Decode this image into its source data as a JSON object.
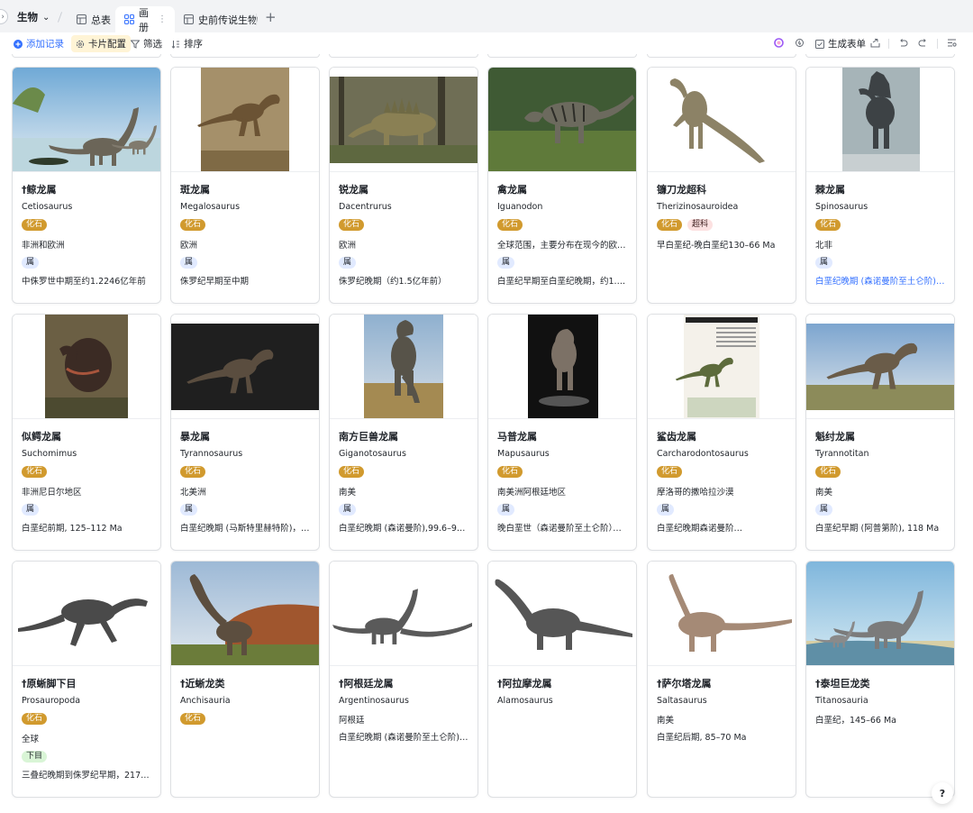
{
  "topbar": {
    "base_name": "生物",
    "tabs": [
      {
        "label": "总表",
        "icon": "grid-table-icon"
      },
      {
        "label": "画册",
        "icon": "gallery-icon",
        "active": true
      },
      {
        "label": "史前传说生物",
        "icon": "grid-table-icon"
      }
    ],
    "add_tab": "+"
  },
  "toolbar": {
    "add_record": "添加记录",
    "card_config": "卡片配置",
    "filter": "筛选",
    "sort": "排序",
    "generate_form": "生成表单"
  },
  "colors": {
    "accent": "#3370ff",
    "fossil_tag": "#d19a2e",
    "genus_tag": "#e1eaff",
    "superfamily_tag": "#fce1e1",
    "order_tag": "#d9f5d6"
  },
  "cards": [
    {
      "title": "†鲸龙属",
      "latin": "Cetiosaurus",
      "tags": [
        "化石"
      ],
      "region": "非洲和欧洲",
      "rank": "属",
      "period": "中侏罗世中期至约1.2246亿年前",
      "img": "sauropod-lake"
    },
    {
      "title": "斑龙属",
      "latin": "Megalosaurus",
      "tags": [
        "化石"
      ],
      "region": "欧洲",
      "rank": "属",
      "period": "侏罗纪早期至中期",
      "img": "theropod-brown"
    },
    {
      "title": "锐龙属",
      "latin": "Dacentrurus",
      "tags": [
        "化石"
      ],
      "region": "欧洲",
      "rank": "属",
      "period": "侏罗纪晚期（约1.5亿年前）",
      "img": "stegosaur-forest"
    },
    {
      "title": "禽龙属",
      "latin": "Iguanodon",
      "tags": [
        "化石"
      ],
      "region": "全球范围，主要分布在现今的欧洲…",
      "rank": "属",
      "period": "白垩纪早期至白垩纪晚期，约1.45…",
      "img": "iguanodon-jungle"
    },
    {
      "title": "镰刀龙超科",
      "latin": "Therizinosauroidea",
      "tags": [
        "化石",
        "超科"
      ],
      "region": "早白垩纪-晚白垩纪130–66 Ma",
      "rank": "",
      "period": "",
      "img": "therizino-white"
    },
    {
      "title": "棘龙属",
      "latin": "Spinosaurus",
      "tags": [
        "化石"
      ],
      "region": "北非",
      "rank": "属",
      "period": "白垩纪晚期 (森诺曼阶至土仑阶)，9…",
      "period_link": true,
      "img": "spinosaurus-mist"
    },
    {
      "title": "似鳄龙属",
      "latin": "Suchomimus",
      "tags": [
        "化石"
      ],
      "region": "非洲尼日尔地区",
      "rank": "属",
      "period": "白垩纪前期, 125–112 Ma",
      "img": "suchomimus-wood"
    },
    {
      "title": "暴龙属",
      "latin": "Tyrannosaurus",
      "tags": [
        "化石"
      ],
      "region": "北美洲",
      "rank": "属",
      "period": "白垩纪晚期 (马斯特里赫特阶)，68…",
      "img": "trex-dark"
    },
    {
      "title": "南方巨兽龙属",
      "latin": "Giganotosaurus",
      "tags": [
        "化石"
      ],
      "region": "南美",
      "rank": "属",
      "period": "白垩纪晚期 (森诺曼阶),99.6–97 Ma",
      "img": "giganoto-plain"
    },
    {
      "title": "马普龙属",
      "latin": "Mapusaurus",
      "tags": [
        "化石"
      ],
      "region": "南美洲阿根廷地区",
      "rank": "属",
      "period": "晚白垩世（森诺曼阶至土仑阶），…",
      "img": "mapusaurus-statue"
    },
    {
      "title": "鲨齿龙属",
      "latin": "Carcharodontosaurus",
      "tags": [
        "化石"
      ],
      "region": "摩洛哥的撒哈拉沙漠",
      "rank": "属",
      "period": "白垩纪晚期森诺曼阶…",
      "img": "carcharo-page"
    },
    {
      "title": "魁纣龙属",
      "latin": "Tyrannotitan",
      "tags": [
        "化石"
      ],
      "region": "南美",
      "rank": "属",
      "period": "白垩纪早期 (阿普第阶), 118 Ma",
      "img": "tyrannotitan-savanna"
    },
    {
      "title": "†原蜥脚下目",
      "latin": "Prosauropoda",
      "tags": [
        "化石"
      ],
      "region": "全球",
      "rank": "下目",
      "period": "三叠纪晚期到侏罗纪早期，217–18…",
      "img": "prosauropod-sketch"
    },
    {
      "title": "†近蜥龙类",
      "latin": "Anchisauria",
      "tags": [
        "化石"
      ],
      "region": "",
      "rank": "",
      "period": "",
      "img": "anchisaur-desert"
    },
    {
      "title": "†阿根廷龙属",
      "latin": "Argentinosaurus",
      "tags": [],
      "region": "阿根廷",
      "rank": "",
      "period": "白垩纪晚期 (森诺曼阶至土仑阶),…",
      "img": "argentino-white"
    },
    {
      "title": "†阿拉摩龙属",
      "latin": "Alamosaurus",
      "tags": [],
      "region": "",
      "rank": "",
      "period": "",
      "img": "alamo-white"
    },
    {
      "title": "†萨尔塔龙属",
      "latin": "Saltasaurus",
      "tags": [],
      "region": "南美",
      "rank": "",
      "period": "白垩纪后期, 85–70 Ma",
      "img": "saltasaur-white"
    },
    {
      "title": "†泰坦巨龙类",
      "latin": "Titanosauria",
      "tags": [],
      "region": "白垩纪，145–66 Ma",
      "rank": "",
      "period": "",
      "img": "titanosaur-lake"
    }
  ],
  "help": "?"
}
